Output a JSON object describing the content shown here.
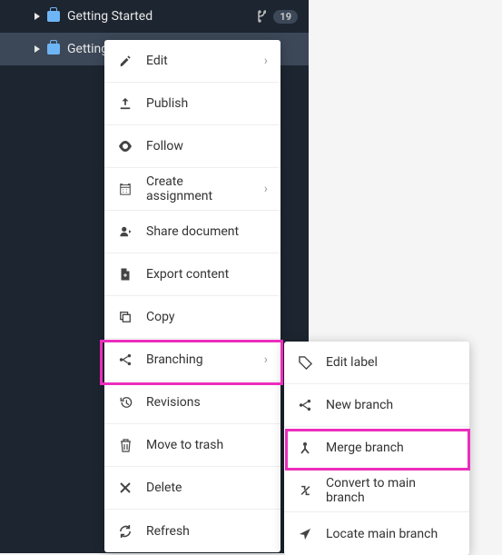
{
  "sidebar": {
    "items": [
      {
        "label": "Getting Started",
        "badge": "19"
      },
      {
        "label": "Getting"
      }
    ]
  },
  "menu": {
    "items": [
      {
        "label": "Edit",
        "hasSubmenu": true
      },
      {
        "label": "Publish"
      },
      {
        "label": "Follow"
      },
      {
        "label": "Create assignment",
        "hasSubmenu": true
      },
      {
        "label": "Share document"
      },
      {
        "label": "Export content"
      },
      {
        "label": "Copy"
      },
      {
        "label": "Branching",
        "hasSubmenu": true,
        "highlighted": true
      },
      {
        "label": "Revisions"
      },
      {
        "label": "Move to trash"
      },
      {
        "label": "Delete"
      },
      {
        "label": "Refresh"
      }
    ]
  },
  "submenu": {
    "items": [
      {
        "label": "Edit label"
      },
      {
        "label": "New branch"
      },
      {
        "label": "Merge branch",
        "highlighted": true
      },
      {
        "label": "Convert to main branch"
      },
      {
        "label": "Locate main branch"
      }
    ]
  }
}
